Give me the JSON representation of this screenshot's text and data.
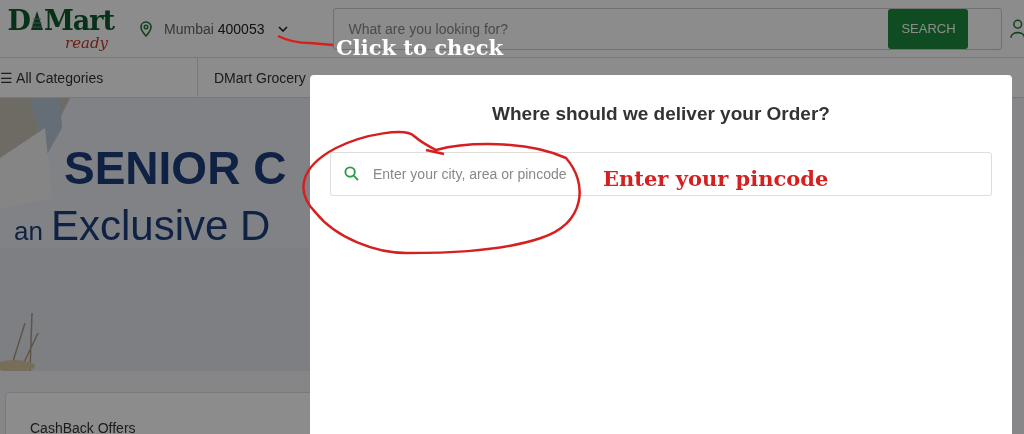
{
  "header": {
    "logo": {
      "left": "D",
      "right": "Mart",
      "sub": "ready"
    },
    "location": {
      "city": "Mumbai",
      "pincode": "400053"
    },
    "search": {
      "placeholder": "What are you looking for?",
      "button": "SEARCH"
    }
  },
  "nav": [
    {
      "kind": "menu",
      "icon": "☰",
      "label": "All Categories"
    },
    {
      "kind": "link",
      "label": "DMart Grocery"
    }
  ],
  "banner": {
    "kind": "picture",
    "headline": "SENIOR C",
    "subline_prefix": "an",
    "subline": "Exclusive D"
  },
  "offers": {
    "title": "CashBack Offers"
  },
  "modal": {
    "title": "Where should we deliver your Order?",
    "search": {
      "placeholder": "Enter your city, area or pincode"
    }
  },
  "annotations": [
    {
      "kind": "arrow",
      "text": "Click to check"
    },
    {
      "kind": "circle",
      "text": "Enter your pincode"
    }
  ]
}
